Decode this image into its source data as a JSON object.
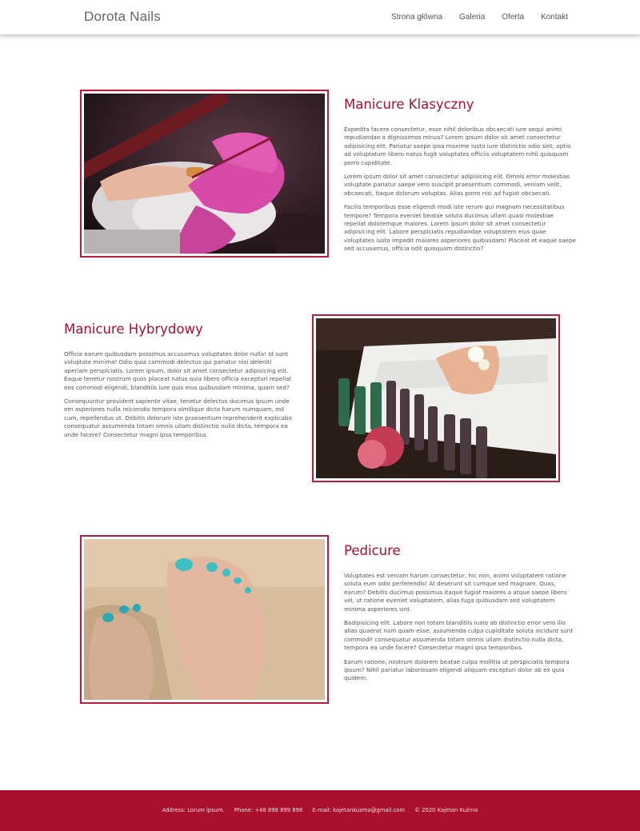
{
  "header": {
    "brand": "Dorota Nails",
    "nav": [
      "Strona główna",
      "Galeria",
      "Oferta",
      "Kontakt"
    ]
  },
  "sections": [
    {
      "title": "Manicure Klasyczny",
      "paragraphs": [
        "Expedita facere consectetur, esse nihil doloribus obcaecati iure sequi animi repudiandae a dignissimos minus? Lorem ipsum dolor sit amet consectetur adipisicing elit. Pariatur saepe ipsa maxime iusto iure distinctio odio sint, optio ad voluptatum libero natus fugit voluptates officiis voluptatem nihil quisquam porro cupiditate.",
        "Lorem ipsum dolor sit amet consectetur adipisicing elit. Omnis error molestias voluptate pariatur saepe vero suscipit praesentium commodi, veniam velit, obcaecati, itaque dolorum voluptas. Alias porro nisi ad fugiat obcaecati.",
        "Facilis temporibus esse eligendi modi iste rerum qui magnam necessitatibus tempore? Tempora eveniet beatae soluta ducimus ullam quasi molestiae repellat doloremque maiores. Lorem ipsum dolor sit amet consectetur adipisicing elit. Labore perspiciatis repudiandae voluptatem eius quae voluptates iusto impedit maiores asperiores quibusdam! Placeat et eaque saepe sed accusamus, officia odit quisquam distinctio?"
      ]
    },
    {
      "title": "Manicure Hybrydowy",
      "paragraphs": [
        "Officia earum quibusdam possimus accusamus voluptates dolor nulla! Id sunt voluptate minima! Odio quia commodi delectus qui pariatur nisi deleniti aperiam perspiciatis. Lorem ipsum, dolor sit amet consectetur adipisicing elit. Eaque tenetur nostrum quos placeat natus quia libero officia excepturi repellat eos commodi eligendi, blanditiis iure quis eius quibusdam minima, quam sed?",
        "Consequuntur provident sapiente vitae, tenetur delectus ducimus ipsum unde em asperiores nulla reiciendis tempora similique dicta harum numquam, est cum, repellendus ut. Debitis dolorum iste praesentium reprehenderit explicabo consequatur assumenda totam omnis ullam distinctio nulla dicta, tempora ea unde facere? Consectetur magni ipsa temporibus."
      ]
    },
    {
      "title": "Pedicure",
      "paragraphs": [
        "Voluptates est veniam harum consectetur, hic non, animi voluptatem ratione soluta eum odio perferendis! At deserunt sit cumque sed magnam. Quas, earum? Debitis ducimus possimus itaque fugiat maiores a atque saepe libero vel, ut ratione eveniet voluptatem, alias fuga quibusdam sed voluptatem minima asperiores sint.",
        "Badipisicing elit. Labore non totam blanditiis iusto ab distinctio error vero illo alias quaerat nam quam esse, assumenda culpa cupiditate soluta incidunt sunt commodi! consequatur assumenda totam omnis ullam distinctio nulla dicta, tempora ea unde facere? Consectetur magni ipsa temporibus.",
        "Earum ratione, nostrum dolorem beatae culpa mollitia ut perspiciatis tempora ipsum? Nihil pariatur laboriosam eligendi aliquam excepturi dolor ab ex quia quidem."
      ]
    }
  ],
  "footer": {
    "address": "Address: Lorum ipsum.",
    "phone": "Phone: +48 898 899 898",
    "email": "E-mail: kajetankuzma@gmail.com",
    "copyright": "© 2020 Kajetan Kuźma"
  },
  "colors": {
    "accent": "#a8102e",
    "frame": "#b81c3c",
    "footer_bg": "#a8102e"
  }
}
